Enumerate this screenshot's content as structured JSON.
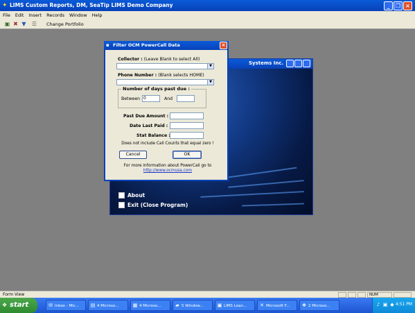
{
  "app": {
    "title": "LIMS Custom Reports, DM, SeaTip LIMS Demo Company",
    "icon": "app-icon"
  },
  "menubar": [
    "File",
    "Edit",
    "Insert",
    "Records",
    "Window",
    "Help"
  ],
  "toolbar": {
    "change_portfolio_label": "Change Portfolio"
  },
  "splash": {
    "title": "Systems Inc.",
    "items": [
      {
        "label": "About"
      },
      {
        "label": "Exit (Close Program)"
      }
    ]
  },
  "dialog": {
    "title": "Filter OCM PowerCall Data",
    "collector": {
      "label": "Collector :",
      "hint": "(Leave Blank to select All)",
      "value": ""
    },
    "phone": {
      "label": "Phone Number :",
      "hint": "(Blank selects HOME)",
      "value": ""
    },
    "days_group": {
      "label": "Number of days past due :",
      "between_label": "Between",
      "between_value": "0",
      "and_label": "And",
      "and_value": ""
    },
    "past_due_amount_label": "Past Due Amount :",
    "date_last_paid_label": "Date Last Paid :",
    "stat_balance_label": "Stat Balance :",
    "zero_note": "Does not include Call Counts that equal zero !",
    "cancel_label": "Cancel",
    "ok_label": "OK",
    "info_text": "For more information about PowerCall go to",
    "info_link": "http://www.ocmusa.com"
  },
  "statusbar": {
    "text": "Form View",
    "num": "NUM"
  },
  "taskbar": {
    "start_label": "start",
    "tasks": [
      {
        "label": "Inbox - Mic...",
        "icon": "outlook-icon"
      },
      {
        "label": "4 Microso...",
        "icon": "access-icon"
      },
      {
        "label": "4 Microso...",
        "icon": "word-icon"
      },
      {
        "label": "5 Window...",
        "icon": "explorer-icon"
      },
      {
        "label": "LIMS Loan...",
        "icon": "lims-icon"
      },
      {
        "label": "Microsoft F...",
        "icon": "frontpage-icon"
      },
      {
        "label": "2 Microso...",
        "icon": "windows-icon"
      }
    ],
    "clock": "4:51 PM"
  }
}
